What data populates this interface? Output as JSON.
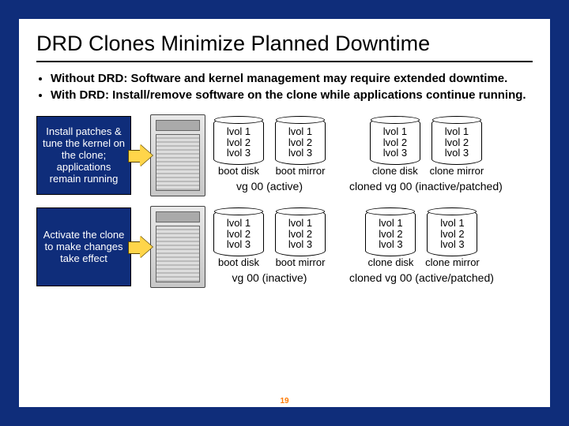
{
  "title": "DRD Clones Minimize Planned Downtime",
  "bullets": {
    "b1": "Without DRD: Software  and kernel management may require extended downtime.",
    "b2": "With DRD: Install/remove software on the clone while applications continue running."
  },
  "rows": [
    {
      "note": "Install patches & tune the kernel on the clone; applications remain running",
      "boot": {
        "lv": {
          "a": "lvol 1",
          "b": "lvol 2",
          "c": "lvol 3"
        },
        "disk_label": "boot disk",
        "mirror_label": "boot mirror",
        "vg_label": "vg 00 (active)"
      },
      "clone": {
        "lv": {
          "a": "lvol 1",
          "b": "lvol 2",
          "c": "lvol 3"
        },
        "disk_label": "clone disk",
        "mirror_label": "clone mirror",
        "vg_label": "cloned vg 00 (inactive/patched)"
      }
    },
    {
      "note": "Activate the clone to make changes take effect",
      "boot": {
        "lv": {
          "a": "lvol 1",
          "b": "lvol 2",
          "c": "lvol 3"
        },
        "disk_label": "boot disk",
        "mirror_label": "boot mirror",
        "vg_label": "vg 00 (inactive)"
      },
      "clone": {
        "lv": {
          "a": "lvol 1",
          "b": "lvol 2",
          "c": "lvol 3"
        },
        "disk_label": "clone disk",
        "mirror_label": "clone mirror",
        "vg_label": "cloned vg 00 (active/patched)"
      }
    }
  ],
  "page_number": "19"
}
